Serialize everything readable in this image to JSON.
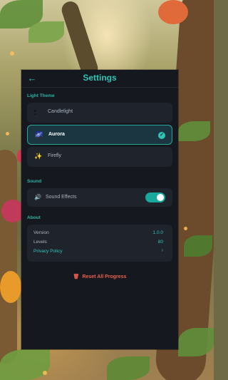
{
  "header": {
    "title": "Settings",
    "back_icon": "arrow-left-icon"
  },
  "light_theme": {
    "section_label": "Light Theme",
    "items": [
      {
        "label": "Candlelight",
        "icon": "candle-icon",
        "selected": false
      },
      {
        "label": "Aurora",
        "icon": "galaxy-icon",
        "selected": true
      },
      {
        "label": "Firefly",
        "icon": "sparkles-icon",
        "selected": false
      }
    ]
  },
  "sound": {
    "section_label": "Sound",
    "effects_label": "Sound Effects",
    "effects_on": true
  },
  "about": {
    "section_label": "About",
    "version_label": "Version",
    "version_value": "1.0.0",
    "levels_label": "Levels",
    "levels_value": "80",
    "privacy_label": "Privacy Policy"
  },
  "reset_label": "Reset All Progress",
  "colors": {
    "accent": "#2ec4b6",
    "panel": "#15181e",
    "card": "#1f242c",
    "danger": "#e8604c"
  }
}
